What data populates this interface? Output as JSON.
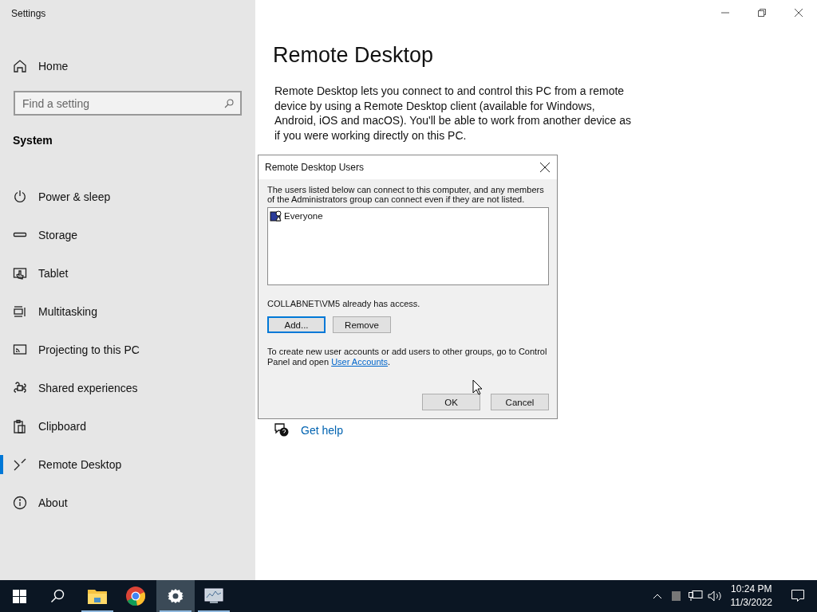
{
  "window": {
    "title": "Settings"
  },
  "sidebar": {
    "home": "Home",
    "search": {
      "placeholder": "Find a setting"
    },
    "section": "System",
    "items": [
      {
        "label": "Power & sleep",
        "selected": false
      },
      {
        "label": "Storage",
        "selected": false
      },
      {
        "label": "Tablet",
        "selected": false
      },
      {
        "label": "Multitasking",
        "selected": false
      },
      {
        "label": "Projecting to this PC",
        "selected": false
      },
      {
        "label": "Shared experiences",
        "selected": false
      },
      {
        "label": "Clipboard",
        "selected": false
      },
      {
        "label": "Remote Desktop",
        "selected": true
      },
      {
        "label": "About",
        "selected": false
      }
    ]
  },
  "main": {
    "title": "Remote Desktop",
    "description": "Remote Desktop lets you connect to and control this PC from a remote device by using a Remote Desktop client (available for Windows, Android, iOS and macOS). You'll be able to work from another device as if you were working directly on this PC.",
    "help_link": "Get help"
  },
  "dialog": {
    "title": "Remote Desktop Users",
    "intro": "The users listed below can connect to this computer, and any members of the Administrators group can connect even if they are not listed.",
    "users": [
      "Everyone"
    ],
    "status": "COLLABNET\\VM5 already has access.",
    "list_buttons": [
      {
        "label": "Add...",
        "default": true
      },
      {
        "label": "Remove",
        "default": false
      }
    ],
    "note": "To create new user accounts or add users to other groups, go to Control Panel and open",
    "note_link": "User Accounts",
    "note_end": ".",
    "buttons": [
      {
        "label": "OK",
        "default": false
      },
      {
        "label": "Cancel",
        "default": false
      }
    ]
  },
  "taskbar": {
    "items": [
      {
        "kind": "start",
        "running": false,
        "selected": false
      },
      {
        "kind": "search",
        "running": false,
        "selected": false
      },
      {
        "kind": "explorer",
        "running": true,
        "selected": false
      },
      {
        "kind": "chrome",
        "running": false,
        "selected": false
      },
      {
        "kind": "settings",
        "running": true,
        "selected": true
      },
      {
        "kind": "monitor",
        "running": true,
        "selected": false
      }
    ],
    "time": "10:24 PM",
    "date": "11/3/2022"
  }
}
